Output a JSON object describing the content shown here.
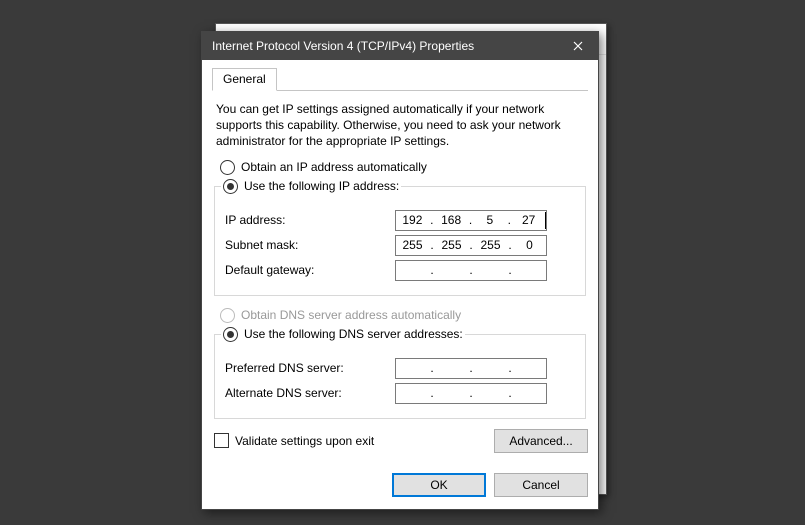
{
  "window": {
    "title": "Internet Protocol Version 4 (TCP/IPv4) Properties"
  },
  "tabs": {
    "general": "General"
  },
  "intro": "You can get IP settings assigned automatically if your network supports this capability. Otherwise, you need to ask your network administrator for the appropriate IP settings.",
  "ip": {
    "radio_auto": "Obtain an IP address automatically",
    "radio_manual": "Use the following IP address:",
    "label_ip": "IP address:",
    "label_subnet": "Subnet mask:",
    "label_gateway": "Default gateway:",
    "ip_oct": [
      "192",
      "168",
      "5",
      "27"
    ],
    "subnet_oct": [
      "255",
      "255",
      "255",
      "0"
    ],
    "gateway_oct": [
      "",
      "",
      "",
      ""
    ]
  },
  "dns": {
    "radio_auto": "Obtain DNS server address automatically",
    "radio_manual": "Use the following DNS server addresses:",
    "label_pref": "Preferred DNS server:",
    "label_alt": "Alternate DNS server:",
    "pref_oct": [
      "",
      "",
      "",
      ""
    ],
    "alt_oct": [
      "",
      "",
      "",
      ""
    ]
  },
  "validate_label": "Validate settings upon exit",
  "buttons": {
    "advanced": "Advanced...",
    "ok": "OK",
    "cancel": "Cancel"
  }
}
